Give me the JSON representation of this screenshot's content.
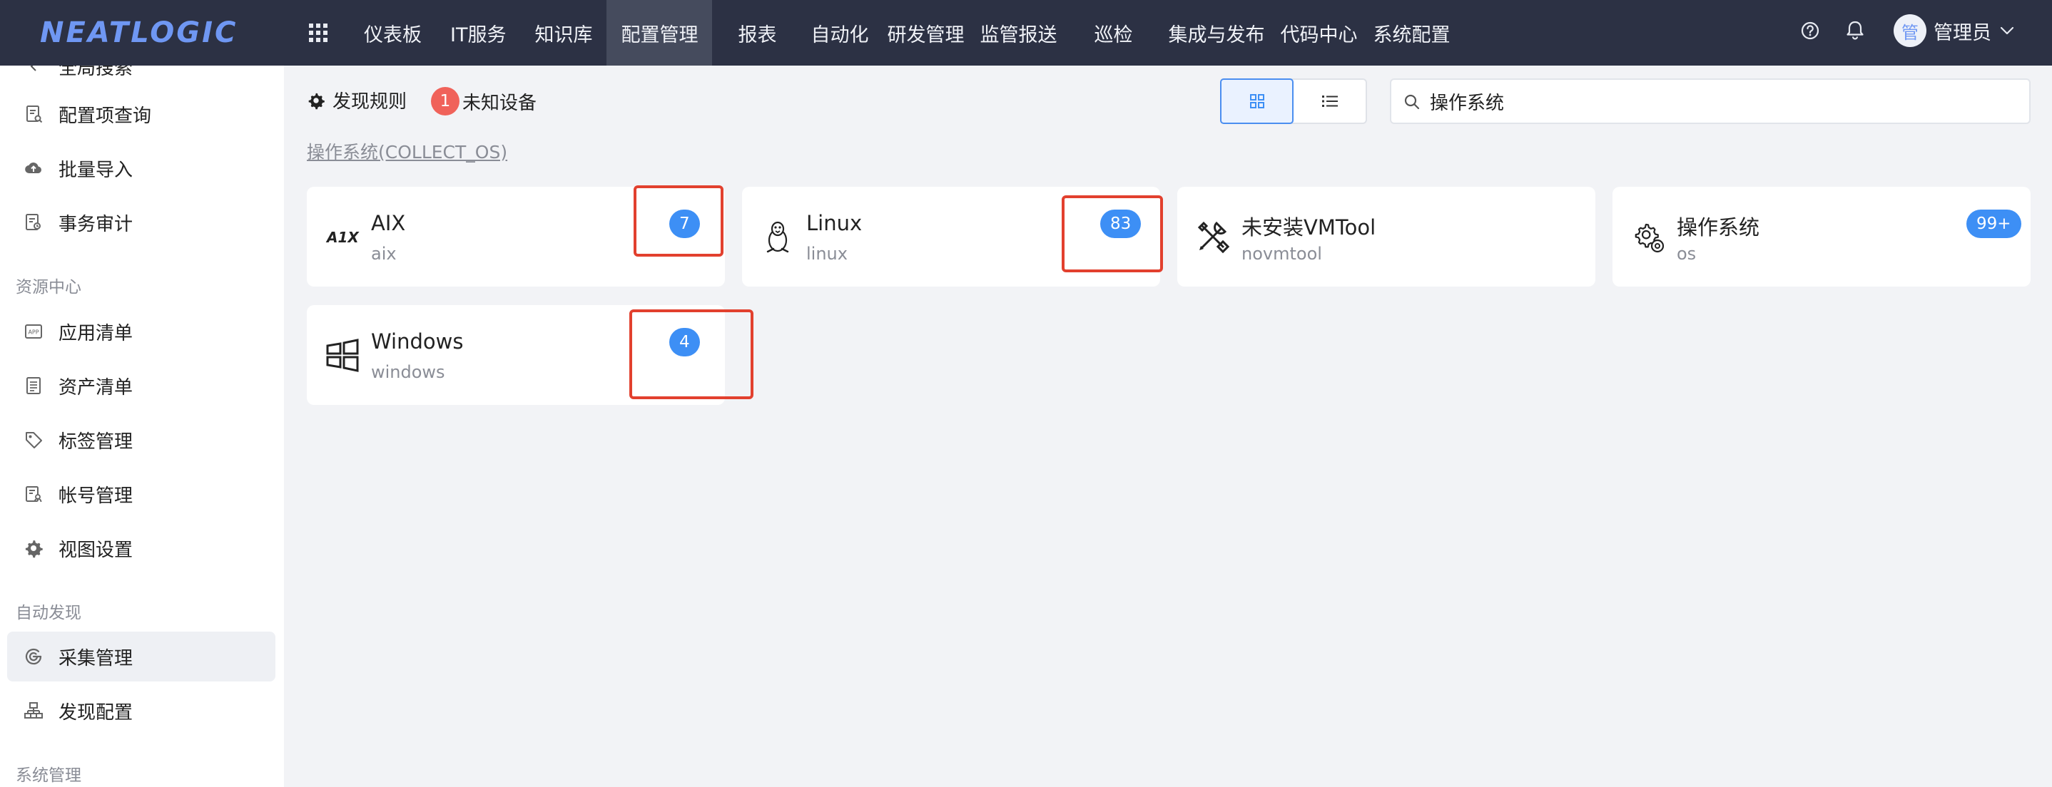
{
  "brand": {
    "logo_text": "NEATLOGIC"
  },
  "nav": {
    "items": [
      {
        "label": "仪表板",
        "active": false
      },
      {
        "label": "IT服务",
        "active": false
      },
      {
        "label": "知识库",
        "active": false
      },
      {
        "label": "配置管理",
        "active": true
      },
      {
        "label": "报表",
        "active": false
      },
      {
        "label": "自动化",
        "active": false
      },
      {
        "label": "研发管理",
        "active": false
      },
      {
        "label": "监管报送",
        "active": false
      },
      {
        "label": "巡检",
        "active": false
      },
      {
        "label": "集成与发布",
        "active": false
      },
      {
        "label": "代码中心",
        "active": false
      },
      {
        "label": "系统配置",
        "active": false
      }
    ]
  },
  "user": {
    "avatar_text": "管",
    "name": "管理员"
  },
  "sidebar": {
    "partial_top_label": "全局搜索",
    "items_group1": [
      {
        "label": "配置项查询",
        "icon": "ci-query-icon"
      },
      {
        "label": "批量导入",
        "icon": "cloud-upload-icon"
      },
      {
        "label": "事务审计",
        "icon": "audit-icon"
      }
    ],
    "group_resource": "资源中心",
    "items_group2": [
      {
        "label": "应用清单",
        "icon": "app-list-icon"
      },
      {
        "label": "资产清单",
        "icon": "asset-list-icon"
      },
      {
        "label": "标签管理",
        "icon": "tag-icon"
      },
      {
        "label": "帐号管理",
        "icon": "account-icon"
      },
      {
        "label": "视图设置",
        "icon": "gear-icon"
      }
    ],
    "group_discovery": "自动发现",
    "items_group3": [
      {
        "label": "采集管理",
        "icon": "collect-icon",
        "active": true
      },
      {
        "label": "发现配置",
        "icon": "sitemap-icon"
      }
    ],
    "group_system": "系统管理"
  },
  "toolbar": {
    "discover_rule_label": "发现规则",
    "unknown_count": "1",
    "unknown_label": "未知设备",
    "search_value": "操作系统"
  },
  "section": {
    "title": "操作系统(COLLECT_OS)"
  },
  "cards": [
    {
      "name": "AIX",
      "code": "aix",
      "count": "7",
      "icon": "aix-icon"
    },
    {
      "name": "Linux",
      "code": "linux",
      "count": "83",
      "icon": "linux-penguin-icon"
    },
    {
      "name": "未安装VMTool",
      "code": "novmtool",
      "count": "",
      "icon": "tools-icon"
    },
    {
      "name": "操作系统",
      "code": "os",
      "count": "99+",
      "icon": "gears-icon"
    },
    {
      "name": "Windows",
      "code": "windows",
      "count": "4",
      "icon": "windows-icon"
    }
  ],
  "colors": {
    "topbar": "#2c3144",
    "accent": "#3d8ff5",
    "highlight": "#e2402e",
    "alert": "#f0625a"
  }
}
